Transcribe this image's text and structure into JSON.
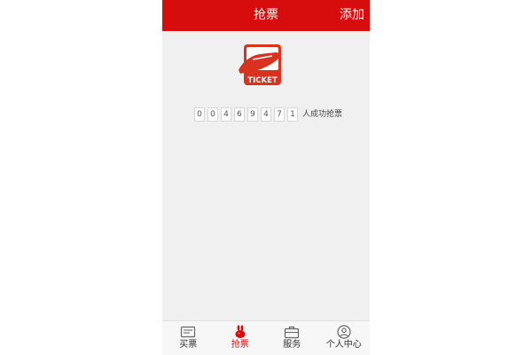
{
  "header": {
    "title": "抢票",
    "action_label": "添加"
  },
  "logo": {
    "text": "TICKET"
  },
  "counter": {
    "digits": [
      "0",
      "0",
      "4",
      "6",
      "9",
      "4",
      "7",
      "1"
    ],
    "label": "人成功抢票"
  },
  "tabbar": {
    "tabs": [
      {
        "label": "买票",
        "icon": "ticket-icon",
        "active": false
      },
      {
        "label": "抢票",
        "icon": "rabbit-icon",
        "active": true
      },
      {
        "label": "服务",
        "icon": "briefcase-icon",
        "active": false
      },
      {
        "label": "个人中心",
        "icon": "user-icon",
        "active": false
      }
    ]
  },
  "colors": {
    "brand": "#d70c0c",
    "background": "#f0f0f0"
  }
}
